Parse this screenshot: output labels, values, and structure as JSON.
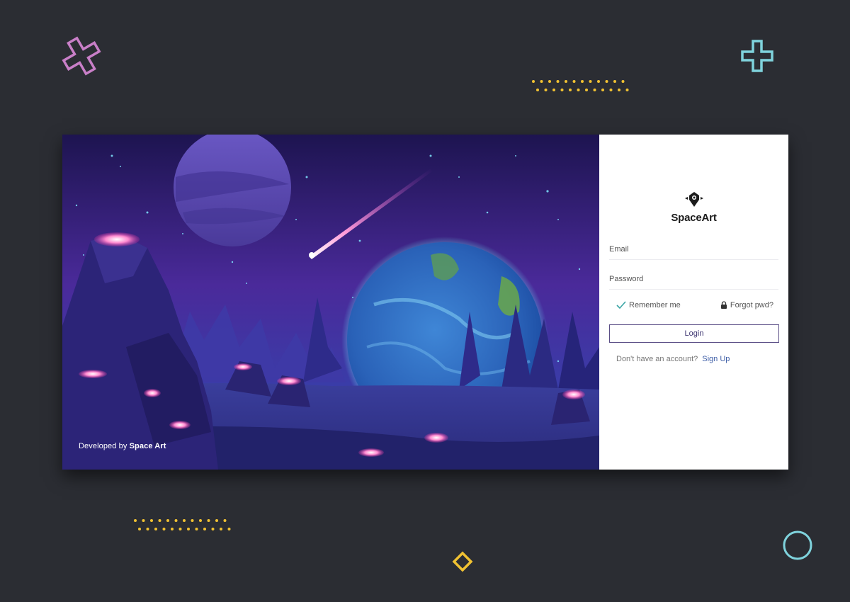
{
  "brand": {
    "name": "SpaceArt"
  },
  "hero": {
    "credit_prefix": "Developed by",
    "credit_name": "Space Art"
  },
  "form": {
    "email_placeholder": "Email",
    "password_placeholder": "Password",
    "remember_label": "Remember me",
    "forgot_label": "Forgot pwd?",
    "login_label": "Login",
    "signup_prompt": "Don't have an account?",
    "signup_link": "Sign Up"
  },
  "icons": {
    "remember": "check-icon",
    "forgot": "lock-icon",
    "logo": "spaceart-logo-icon"
  },
  "colors": {
    "background": "#2b2d33",
    "accent_pink": "#c97fc8",
    "accent_cyan": "#7fd3dd",
    "accent_yellow": "#f1c232",
    "button_border": "#5a4e86",
    "link": "#3d5da6"
  }
}
